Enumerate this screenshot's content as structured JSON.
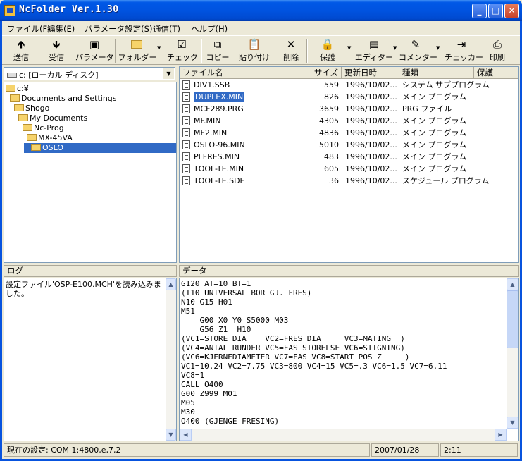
{
  "window": {
    "title": "NcFolder Ver.1.30"
  },
  "menu": [
    "ファイル(F)",
    "編集(E)",
    "パラメータ設定(S)",
    "通信(T)",
    "ヘルプ(H)"
  ],
  "toolbar": [
    {
      "label": "送信",
      "icon": "send-icon"
    },
    {
      "label": "受信",
      "icon": "receive-icon"
    },
    {
      "label": "パラメータ",
      "icon": "parameter-icon"
    },
    {
      "label": "フォルダー",
      "icon": "folder-icon"
    },
    {
      "label": "チェック",
      "icon": "checkbox-icon"
    },
    {
      "label": "コピー",
      "icon": "copy-icon"
    },
    {
      "label": "貼り付け",
      "icon": "paste-icon"
    },
    {
      "label": "削除",
      "icon": "delete-icon"
    },
    {
      "label": "保護",
      "icon": "lock-icon"
    },
    {
      "label": "エディター",
      "icon": "editor-icon"
    },
    {
      "label": "コメンター",
      "icon": "commenter-icon"
    },
    {
      "label": "チェッカー",
      "icon": "checker-icon"
    },
    {
      "label": "印刷",
      "icon": "print-icon"
    }
  ],
  "drive": {
    "label": "c: [ローカル ディスク]"
  },
  "tree": [
    {
      "label": "c:¥"
    },
    {
      "label": "Documents and Settings"
    },
    {
      "label": "Shogo"
    },
    {
      "label": "My Documents"
    },
    {
      "label": "Nc-Prog"
    },
    {
      "label": "MX-45VA"
    },
    {
      "label": "OSLO"
    }
  ],
  "filelist": {
    "headers": [
      "ファイル名",
      "サイズ",
      "更新日時",
      "種類",
      "保護"
    ],
    "rows": [
      {
        "name": "DIV1.SSB",
        "size": "559",
        "date": "1996/10/02...",
        "type": "システム サブプログラム"
      },
      {
        "name": "DUPLEX.MIN",
        "size": "826",
        "date": "1996/10/02...",
        "type": "メイン プログラム"
      },
      {
        "name": "MCF289.PRG",
        "size": "3659",
        "date": "1996/10/02...",
        "type": "PRG ファイル"
      },
      {
        "name": "MF.MIN",
        "size": "4305",
        "date": "1996/10/02...",
        "type": "メイン プログラム"
      },
      {
        "name": "MF2.MIN",
        "size": "4836",
        "date": "1996/10/02...",
        "type": "メイン プログラム"
      },
      {
        "name": "OSLO-96.MIN",
        "size": "5010",
        "date": "1996/10/02...",
        "type": "メイン プログラム"
      },
      {
        "name": "PLFRES.MIN",
        "size": "483",
        "date": "1996/10/02...",
        "type": "メイン プログラム"
      },
      {
        "name": "TOOL-TE.MIN",
        "size": "605",
        "date": "1996/10/02...",
        "type": "メイン プログラム"
      },
      {
        "name": "TOOL-TE.SDF",
        "size": "36",
        "date": "1996/10/02...",
        "type": "スケジュール プログラム"
      }
    ]
  },
  "log": {
    "title": "ログ",
    "text": "設定ファイル'OSP-E100.MCH'を読み込みました。"
  },
  "data": {
    "title": "データ",
    "lines": [
      "G120 AT=10 BT=1",
      "(T10 UNIVERSAL BOR GJ. FRES)",
      "N10 G15 H01",
      "M51",
      "    G00 X0 Y0 S5000 M03",
      "    G56 Z1  H10",
      "(VC1=STORE DIA    VC2=FRES DIA     VC3=MATING  )",
      "(VC4=ANTAL RUNDER VC5=FAS STORELSE VC6=STIGNING)",
      "(VC6=KJERNEDIAMETER VC7=FAS VC8=START POS Z     )",
      "VC1=10.24 VC2=7.75 VC3=800 VC4=15 VC5=.3 VC6=1.5 VC7=6.11",
      "VC8=1",
      "CALL O400",
      "G00 Z999 M01",
      "M05",
      "M30",
      "O400 (GJENGE FRESING)"
    ]
  },
  "status": {
    "setting": "現在の設定: COM 1:4800,e,7,2",
    "date": "2007/01/28",
    "time": "2:11"
  },
  "colors": {
    "titlebar": "#0053e0",
    "selection": "#316ac5",
    "face": "#ece9d8"
  }
}
